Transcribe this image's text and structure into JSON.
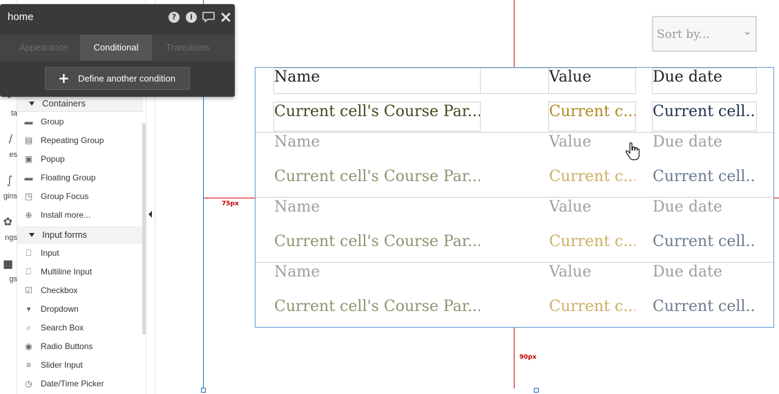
{
  "leftnav": {
    "items": [
      {
        "label": "ta",
        "icon": "data-icon"
      },
      {
        "label": "es",
        "icon": "styles-icon"
      },
      {
        "label": "gins",
        "icon": "plugins-icon"
      },
      {
        "label": "ngs",
        "icon": "settings-icon"
      },
      {
        "label": "gs",
        "icon": "logs-icon"
      }
    ]
  },
  "palette": {
    "sections": [
      {
        "title": "Containers",
        "items": [
          {
            "label": "Group",
            "icon": "folder-icon"
          },
          {
            "label": "Repeating Group",
            "icon": "repeating-group-icon"
          },
          {
            "label": "Popup",
            "icon": "popup-icon"
          },
          {
            "label": "Floating Group",
            "icon": "floating-group-icon"
          },
          {
            "label": "Group Focus",
            "icon": "group-focus-icon"
          },
          {
            "label": "Install more...",
            "icon": "plus-circle-icon"
          }
        ]
      },
      {
        "title": "Input forms",
        "items": [
          {
            "label": "Input",
            "icon": "input-icon"
          },
          {
            "label": "Multiline Input",
            "icon": "multiline-input-icon"
          },
          {
            "label": "Checkbox",
            "icon": "checkbox-icon"
          },
          {
            "label": "Dropdown",
            "icon": "dropdown-icon"
          },
          {
            "label": "Search Box",
            "icon": "search-icon"
          },
          {
            "label": "Radio Buttons",
            "icon": "radio-icon"
          },
          {
            "label": "Slider Input",
            "icon": "slider-icon"
          },
          {
            "label": "Date/Time Picker",
            "icon": "clock-icon"
          }
        ]
      }
    ]
  },
  "editor": {
    "title": "home",
    "icons": [
      "help-icon",
      "info-icon",
      "comment-icon",
      "close-icon"
    ],
    "tabs": [
      {
        "label": "Appearance",
        "active": false
      },
      {
        "label": "Conditional",
        "active": true
      },
      {
        "label": "Transitions",
        "active": false
      }
    ],
    "button_label": "Define another condition"
  },
  "canvas": {
    "sort": {
      "placeholder": "Sort by..."
    },
    "guides": {
      "left_label": "75px",
      "bottom_label": "90px"
    },
    "headers": {
      "name": "Name",
      "value": "Value",
      "due": "Due date"
    },
    "cells": {
      "name": "Current cell's Course Par...",
      "value": "Current c...",
      "due": "Current cell..."
    },
    "colors": {
      "name_primary": "#3b4a1f",
      "value_primary": "#b08a1e",
      "due_primary": "#1f2f4f",
      "name_faded": "#8a9470",
      "value_faded": "#cdae62",
      "due_faded": "#6a7a8e"
    }
  }
}
